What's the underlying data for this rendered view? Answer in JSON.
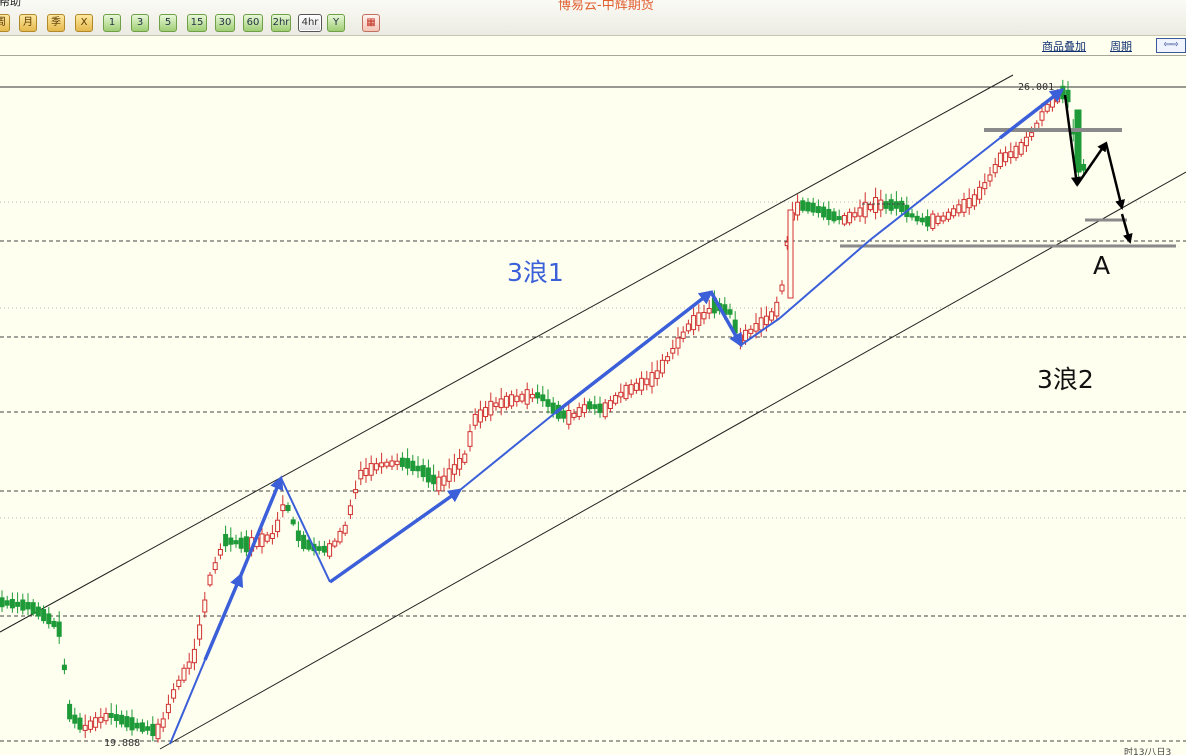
{
  "window": {
    "title": "博易云-中辉期货",
    "menu_help": "帮助"
  },
  "toolbar": {
    "buttons": [
      {
        "label": "周",
        "style": "gold"
      },
      {
        "label": "月",
        "style": "gold"
      },
      {
        "label": "季",
        "style": "gold"
      },
      {
        "label": "X",
        "style": "gold"
      },
      {
        "label": "1",
        "style": "green"
      },
      {
        "label": "3",
        "style": "green"
      },
      {
        "label": "5",
        "style": "green"
      },
      {
        "label": "15",
        "style": "green"
      },
      {
        "label": "30",
        "style": "green"
      },
      {
        "label": "60",
        "style": "green"
      },
      {
        "label": "2hr",
        "style": "green"
      },
      {
        "label": "4hr",
        "style": "active"
      },
      {
        "label": "Y",
        "style": "green"
      },
      {
        "label": "▦",
        "style": "grid"
      }
    ]
  },
  "subbar": {
    "overlay_link": "商品叠加",
    "period_link": "周期",
    "nav_label": "⇦⇨"
  },
  "chart": {
    "high_label": "26.001",
    "low_label": "19.888",
    "wave_label_1": "3浪1",
    "wave_label_2": "3浪2",
    "point_label_a": "A",
    "footer_partial": "时13/八日3",
    "colors": {
      "background": "#fffff0",
      "up_candle": "#d03030",
      "down_candle": "#1e9a38",
      "blue_arrow": "#3a5fd8",
      "black_arrow": "#000000",
      "grey_level": "#8a8a8a",
      "wave1_text": "#3a5fd8",
      "wave2_text": "#111111"
    }
  }
}
